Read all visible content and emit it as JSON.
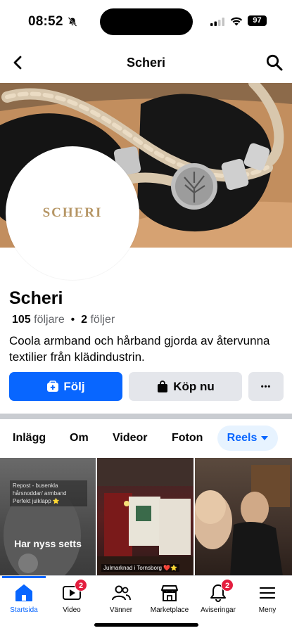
{
  "status_bar": {
    "time": "08:52",
    "battery": "97"
  },
  "nav": {
    "title": "Scheri"
  },
  "profile": {
    "avatar_text": "SCHERI",
    "name": "Scheri",
    "followers_count": "105",
    "followers_label": "följare",
    "separator": "•",
    "following_count": "2",
    "following_label": "följer",
    "bio": "Coola armband och hårband gjorda av återvunna textilier från klädindustrin."
  },
  "actions": {
    "follow_label": "Följ",
    "buy_label": "Köp nu",
    "more_label": "•••"
  },
  "tabs": [
    "Inlägg",
    "Om",
    "Videor",
    "Foton",
    "Reels"
  ],
  "reels": [
    {
      "caption": "Repost - busenkla hårsnoddar/ armband Perfekt julklapp ⭐",
      "overlay": "Har nyss setts"
    },
    {
      "caption": "Julmarknad i Tornsborg ❤️⭐"
    },
    {
      "caption": ""
    }
  ],
  "bottom_nav": [
    {
      "label": "Startsida",
      "icon": "home-icon",
      "active": true
    },
    {
      "label": "Video",
      "icon": "video-icon",
      "badge": "2"
    },
    {
      "label": "Vänner",
      "icon": "friends-icon"
    },
    {
      "label": "Marketplace",
      "icon": "marketplace-icon"
    },
    {
      "label": "Aviseringar",
      "icon": "bell-icon",
      "badge": "2"
    },
    {
      "label": "Meny",
      "icon": "menu-icon"
    }
  ],
  "colors": {
    "accent": "#0866ff",
    "badge": "#e41e3f",
    "logo": "#b69665"
  }
}
